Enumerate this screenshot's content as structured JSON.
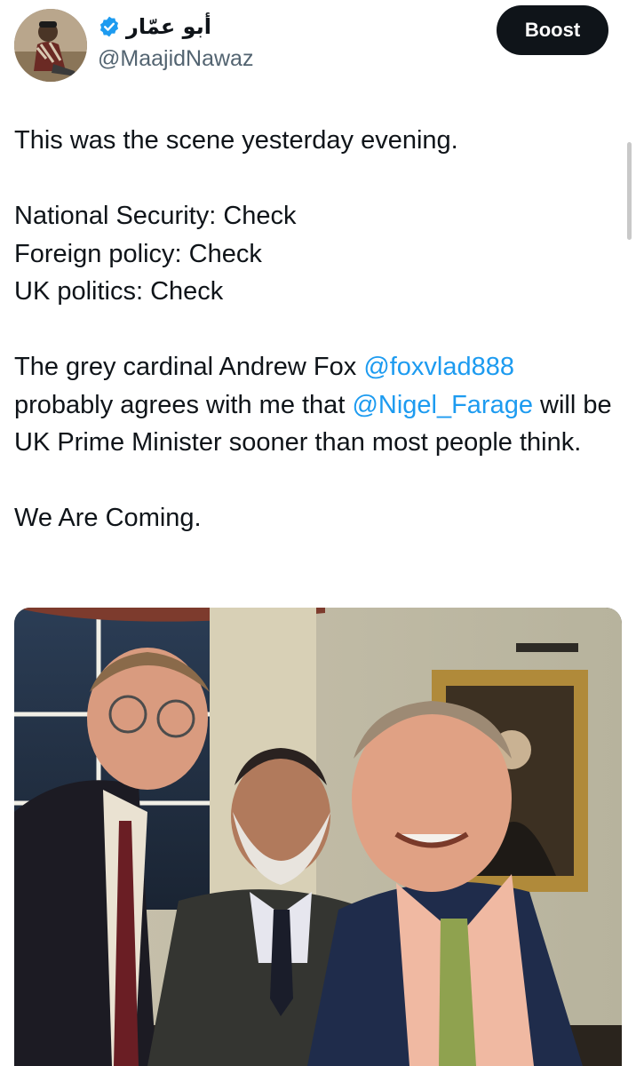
{
  "author": {
    "display_name": "أبو عمّار",
    "handle": "@MaajidNawaz",
    "verified": true,
    "avatar": "profile-photo"
  },
  "actions": {
    "boost_label": "Boost"
  },
  "tweet": {
    "line1": "This was the scene yesterday evening.",
    "line2": "National Security: Check",
    "line3": "Foreign policy: Check",
    "line4": "UK politics: Check",
    "p3_a": "The grey cardinal Andrew Fox ",
    "mention1": "@foxvlad888",
    "p3_b": " probably agrees with me that ",
    "mention2": "@Nigel_Farage",
    "p3_c": " will be UK Prime Minister sooner than most people think.",
    "line_last": "We Are Coming."
  },
  "media": {
    "type": "photo",
    "subject": "three men posing for a selfie indoors in front of a framed portrait painting"
  },
  "colors": {
    "accent": "#1d9bf0",
    "text": "#0f1419",
    "secondary": "#536471",
    "button": "#0f1419"
  }
}
